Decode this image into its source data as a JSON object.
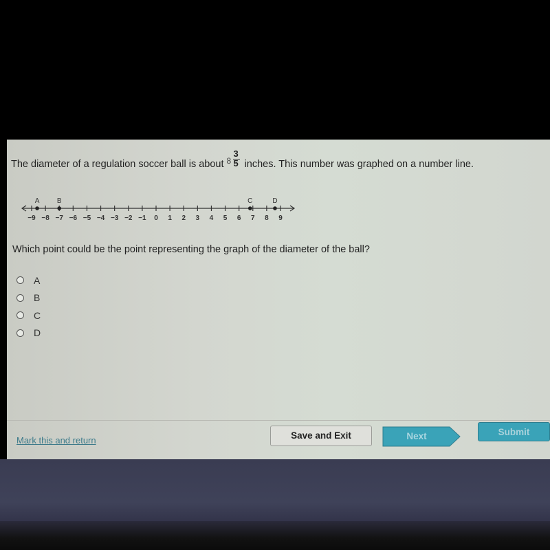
{
  "question": {
    "text_before": "The diameter of a regulation soccer ball is about",
    "mixed_number": {
      "whole": "8",
      "numerator": "3",
      "denominator": "5"
    },
    "text_after": "inches. This number was graphed on a number line."
  },
  "number_line": {
    "min": -9,
    "max": 9,
    "tick_labels": [
      "−9",
      "−8",
      "−7",
      "−6",
      "−5",
      "−4",
      "−3",
      "−2",
      "−1",
      "0",
      "1",
      "2",
      "3",
      "4",
      "5",
      "6",
      "7",
      "8",
      "9"
    ],
    "points": [
      {
        "label": "A",
        "value": -8.6
      },
      {
        "label": "B",
        "value": -7.0
      },
      {
        "label": "C",
        "value": 6.8
      },
      {
        "label": "D",
        "value": 8.6
      }
    ]
  },
  "prompt": "Which point could be the point representing the graph of the diameter of the ball?",
  "options": [
    {
      "label": "A",
      "selected": false
    },
    {
      "label": "B",
      "selected": false
    },
    {
      "label": "C",
      "selected": false
    },
    {
      "label": "D",
      "selected": false
    }
  ],
  "footer": {
    "mark_link": "Mark this and return",
    "save_exit": "Save and Exit",
    "next": "Next",
    "submit": "Submit"
  },
  "colors": {
    "accent_button": "#3aa3b8",
    "link": "#3c7a8a"
  }
}
